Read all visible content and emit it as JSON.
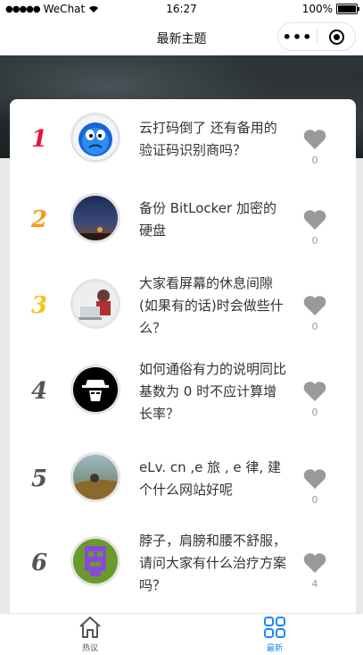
{
  "status_bar": {
    "carrier": "WeChat",
    "time": "16:27",
    "battery": "100%"
  },
  "nav": {
    "title": "最新主题"
  },
  "rank_colors": [
    "#e8143c",
    "#f39c12",
    "#f5c518",
    "#555555",
    "#555555",
    "#555555"
  ],
  "list": [
    {
      "rank": "1",
      "title": "云打码倒了 还有备用的验证码识别商吗？",
      "likes": "0",
      "avatar": "blue-face"
    },
    {
      "rank": "2",
      "title": "备份 BitLocker 加密的硬盘",
      "likes": "0",
      "avatar": "night-sky"
    },
    {
      "rank": "3",
      "title": "大家看屏幕的休息间隙(如果有的话)时会做些什么？",
      "likes": "0",
      "avatar": "person-laptop"
    },
    {
      "rank": "4",
      "title": "如何通俗有力的说明同比基数为 0 时不应计算增长率？",
      "likes": "0",
      "avatar": "hat-mask"
    },
    {
      "rank": "5",
      "title": "eLv. cn ,e 旅 , e 律, 建个什么网站好呢",
      "likes": "0",
      "avatar": "scene"
    },
    {
      "rank": "6",
      "title": "脖子，肩膀和腰不舒服，请问大家有什么治疗方案吗？",
      "likes": "4",
      "avatar": "purple-pixel"
    }
  ],
  "tabs": [
    {
      "label": "热议",
      "icon": "home-icon",
      "active": false
    },
    {
      "label": "最新",
      "icon": "grid-icon",
      "active": true
    }
  ],
  "colors": {
    "active_tab": "#1989fa",
    "inactive_tab": "#555555",
    "heart": "#999999"
  }
}
